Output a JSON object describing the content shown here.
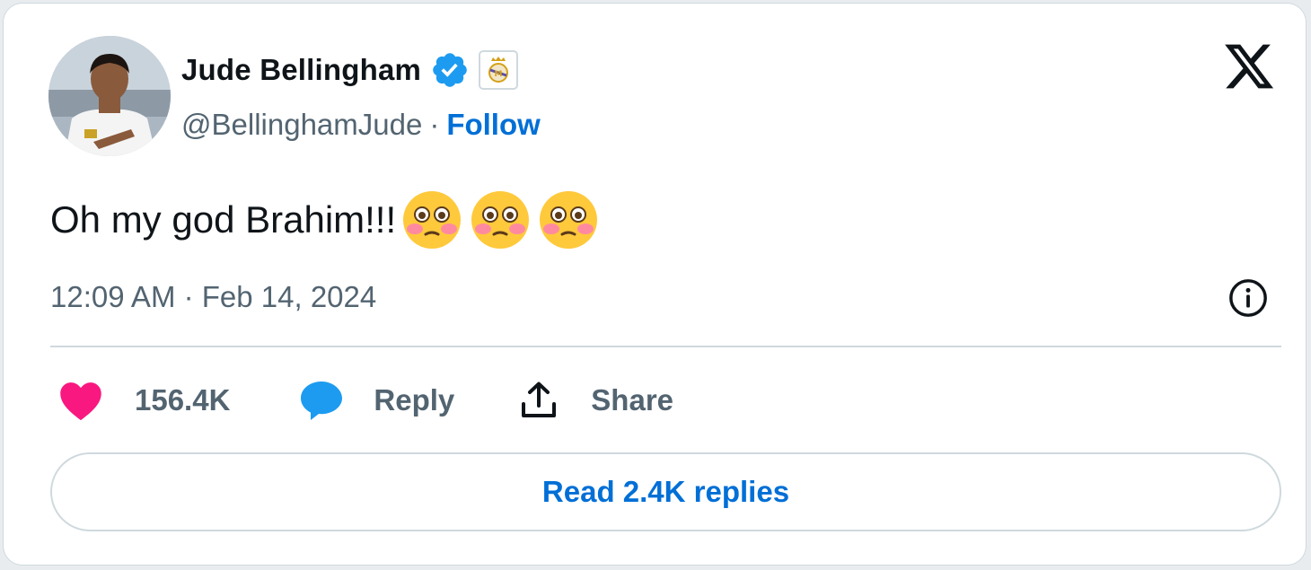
{
  "author": {
    "display_name": "Jude Bellingham",
    "handle": "@BellinghamJude",
    "separator": "·",
    "follow_label": "Follow",
    "verified_icon": "verified-badge-icon",
    "affiliation_icon": "real-madrid-crest-icon"
  },
  "tweet": {
    "text": "Oh my god Brahim!!!",
    "emojis": [
      "flushed-face-emoji",
      "flushed-face-emoji",
      "flushed-face-emoji"
    ],
    "timestamp": "12:09 AM · Feb 14, 2024"
  },
  "actions": {
    "like_count": "156.4K",
    "reply_label": "Reply",
    "share_label": "Share"
  },
  "footer": {
    "read_replies_label": "Read 2.4K replies"
  },
  "colors": {
    "text_primary": "#0f1419",
    "text_secondary": "#536471",
    "link_blue": "#006fd6",
    "verified_blue": "#1d9bf0",
    "like_pink": "#f91880",
    "border": "#cfd9de"
  }
}
